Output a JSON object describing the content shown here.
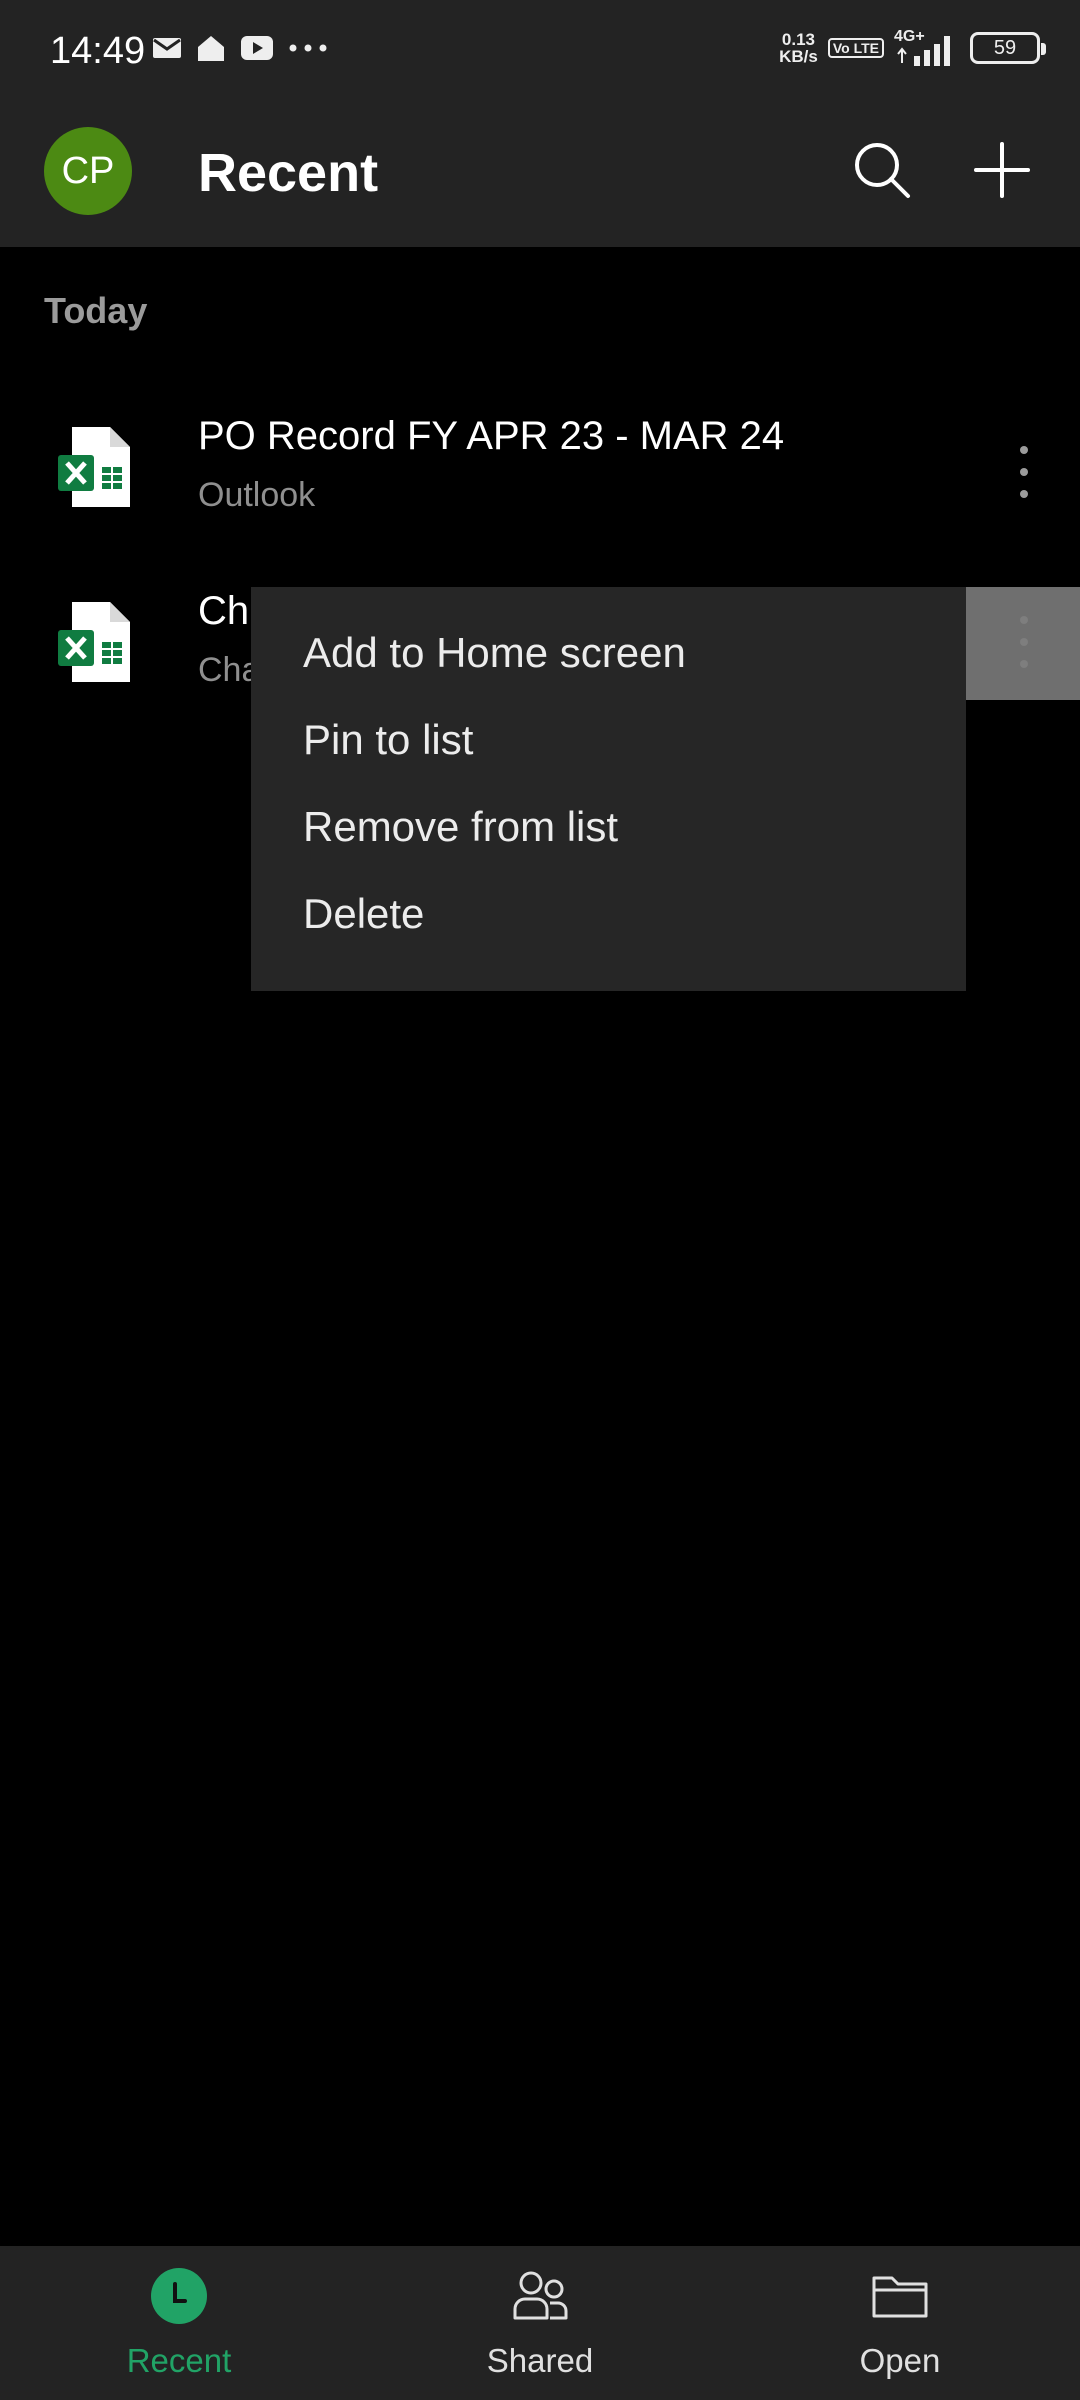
{
  "status_bar": {
    "time": "14:49",
    "net_speed_value": "0.13",
    "net_speed_unit": "KB/s",
    "volte": "Vo LTE",
    "network": "4G+",
    "battery": "59"
  },
  "app_bar": {
    "avatar_initials": "CP",
    "title": "Recent"
  },
  "section_header": "Today",
  "files": [
    {
      "name": "PO Record FY APR 23 - MAR 24",
      "subtitle": "Outlook",
      "icon": "excel-file-icon"
    },
    {
      "name": "Ch",
      "subtitle": "Cha",
      "icon": "excel-file-icon"
    }
  ],
  "context_menu": {
    "items": [
      "Add to Home screen",
      "Pin to list",
      "Remove from list",
      "Delete"
    ]
  },
  "bottom_nav": {
    "items": [
      {
        "label": "Recent",
        "icon": "clock-icon",
        "active": true
      },
      {
        "label": "Shared",
        "icon": "people-icon",
        "active": false
      },
      {
        "label": "Open",
        "icon": "folder-icon",
        "active": false
      }
    ]
  },
  "colors": {
    "accent": "#21a366",
    "avatar": "#4c8a13",
    "bar_background": "#232323",
    "menu_background": "#262626"
  }
}
